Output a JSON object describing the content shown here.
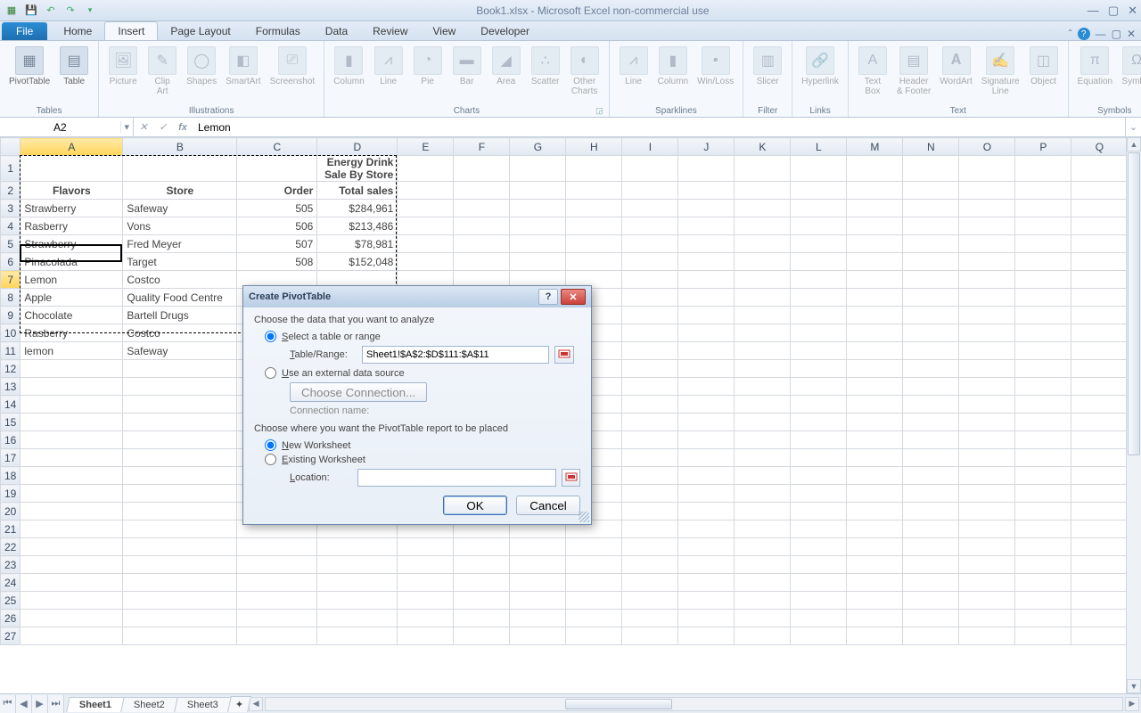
{
  "title": "Book1.xlsx  -  Microsoft Excel non-commercial use",
  "tabs": {
    "file": "File",
    "home": "Home",
    "insert": "Insert",
    "pagelayout": "Page Layout",
    "formulas": "Formulas",
    "data": "Data",
    "review": "Review",
    "view": "View",
    "developer": "Developer"
  },
  "ribbon": {
    "groups": {
      "tables": {
        "label": "Tables",
        "pivot": "PivotTable",
        "table": "Table"
      },
      "illustrations": {
        "label": "Illustrations",
        "picture": "Picture",
        "clipart": "Clip\nArt",
        "shapes": "Shapes",
        "smartart": "SmartArt",
        "screenshot": "Screenshot"
      },
      "charts": {
        "label": "Charts",
        "column": "Column",
        "line": "Line",
        "pie": "Pie",
        "bar": "Bar",
        "area": "Area",
        "scatter": "Scatter",
        "other": "Other\nCharts"
      },
      "sparklines": {
        "label": "Sparklines",
        "sline": "Line",
        "scolumn": "Column",
        "winloss": "Win/Loss"
      },
      "filter": {
        "label": "Filter",
        "slicer": "Slicer"
      },
      "links": {
        "label": "Links",
        "hyperlink": "Hyperlink"
      },
      "text": {
        "label": "Text",
        "textbox": "Text\nBox",
        "headerfooter": "Header\n& Footer",
        "wordart": "WordArt",
        "sigline": "Signature\nLine",
        "object": "Object"
      },
      "symbols": {
        "label": "Symbols",
        "equation": "Equation",
        "symbol": "Symbol"
      }
    }
  },
  "namebox": "A2",
  "formula": "Lemon",
  "columns": [
    "A",
    "B",
    "C",
    "D",
    "E",
    "F",
    "G",
    "H",
    "I",
    "J",
    "K",
    "L",
    "M",
    "N",
    "O",
    "P",
    "Q"
  ],
  "rows": [
    "1",
    "2",
    "3",
    "4",
    "5",
    "6",
    "7",
    "8",
    "9",
    "10",
    "11",
    "12",
    "13",
    "14",
    "15",
    "16",
    "17",
    "18",
    "19",
    "20",
    "21",
    "22",
    "23",
    "24",
    "25",
    "26",
    "27"
  ],
  "sheet": {
    "title": "Energy Drink Sale By Store",
    "headers": {
      "flavors": "Flavors",
      "store": "Store",
      "order": "Order",
      "total": "Total sales"
    },
    "data": [
      {
        "flavor": "Strawberry",
        "store": "Safeway",
        "order": "505",
        "total": "$284,961"
      },
      {
        "flavor": "Rasberry",
        "store": "Vons",
        "order": "506",
        "total": "$213,486"
      },
      {
        "flavor": "Strawberry",
        "store": "Fred Meyer",
        "order": "507",
        "total": "$78,981"
      },
      {
        "flavor": "Pinacolada",
        "store": "Target",
        "order": "508",
        "total": "$152,048"
      },
      {
        "flavor": "Lemon",
        "store": "Costco",
        "order": "",
        "total": ""
      },
      {
        "flavor": "Apple",
        "store": "Quality Food Centre",
        "order": "",
        "total": ""
      },
      {
        "flavor": "Chocolate",
        "store": "Bartell Drugs",
        "order": "",
        "total": ""
      },
      {
        "flavor": "Rasberry",
        "store": "Costco",
        "order": "",
        "total": ""
      },
      {
        "flavor": "lemon",
        "store": "Safeway",
        "order": "",
        "total": ""
      }
    ]
  },
  "sheets": {
    "s1": "Sheet1",
    "s2": "Sheet2",
    "s3": "Sheet3"
  },
  "dialog": {
    "title": "Create PivotTable",
    "choose_data": "Choose the data that you want to analyze",
    "select_range": "Select a table or range",
    "table_range_label": "Table/Range:",
    "table_range_value": "Sheet1!$A$2:$D$111:$A$11",
    "use_external": "Use an external data source",
    "choose_connection": "Choose Connection...",
    "connection_name": "Connection name:",
    "choose_place": "Choose where you want the PivotTable report to be placed",
    "new_ws": "New Worksheet",
    "existing_ws": "Existing Worksheet",
    "location_label": "Location:",
    "location_value": "",
    "ok": "OK",
    "cancel": "Cancel"
  }
}
